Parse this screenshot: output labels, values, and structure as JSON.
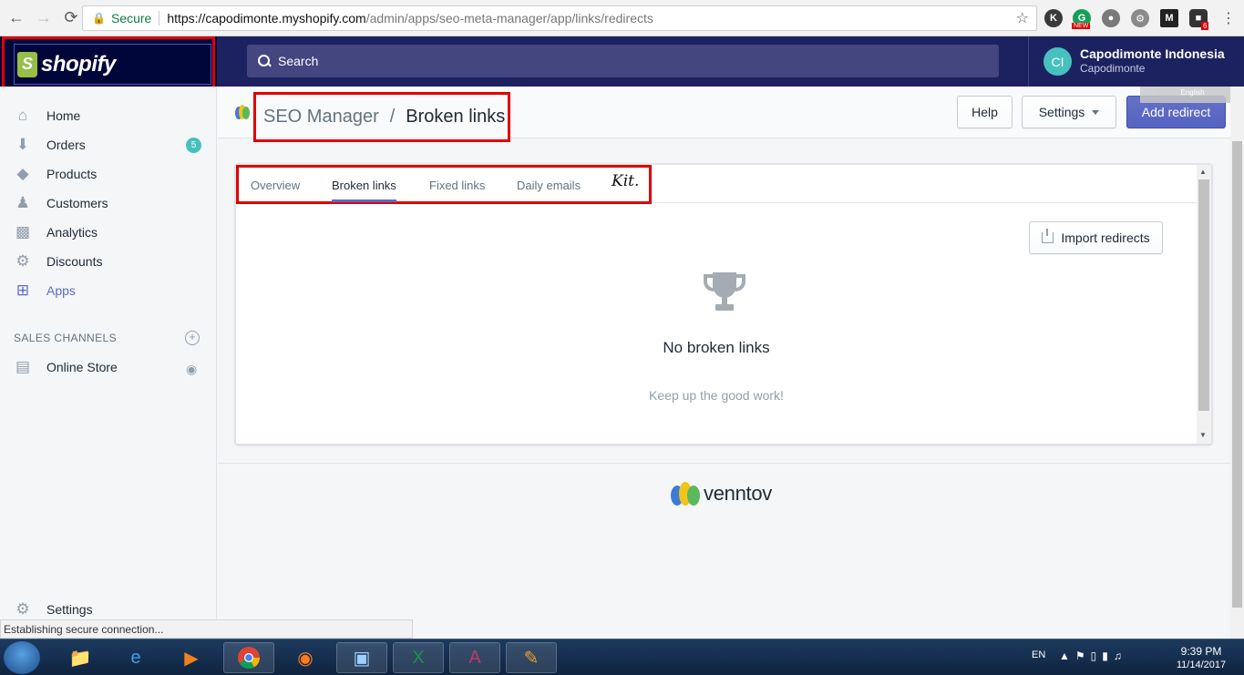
{
  "browser": {
    "secure_label": "Secure",
    "url_host": "https://capodimonte.myshopify.com",
    "url_path": "/admin/apps/seo-meta-manager/app/links/redirects",
    "ext_new_badge": "NEW",
    "ext_count_badge": "6"
  },
  "topbar": {
    "logo_text": "shopify",
    "search_placeholder": "Search",
    "avatar_initials": "CI",
    "store_name": "Capodimonte Indonesia",
    "store_sub": "Capodimonte",
    "language_pill": "English"
  },
  "sidebar": {
    "items": [
      {
        "label": "Home",
        "icon": "home-icon"
      },
      {
        "label": "Orders",
        "icon": "orders-icon",
        "badge": "5"
      },
      {
        "label": "Products",
        "icon": "tag-icon"
      },
      {
        "label": "Customers",
        "icon": "person-icon"
      },
      {
        "label": "Analytics",
        "icon": "bar-chart-icon"
      },
      {
        "label": "Discounts",
        "icon": "discount-icon"
      },
      {
        "label": "Apps",
        "icon": "apps-icon",
        "active": true
      }
    ],
    "sales_channels_label": "SALES CHANNELS",
    "online_store_label": "Online Store",
    "settings_label": "Settings"
  },
  "header": {
    "app_name": "SEO Manager",
    "separator": "/",
    "page_title": "Broken links",
    "help_label": "Help",
    "settings_label": "Settings",
    "add_redirect_label": "Add redirect"
  },
  "tabs": [
    {
      "label": "Overview"
    },
    {
      "label": "Broken links",
      "active": true
    },
    {
      "label": "Fixed links"
    },
    {
      "label": "Daily emails"
    }
  ],
  "tab_kit_label": "Kit.",
  "card": {
    "import_label": "Import redirects",
    "empty_title": "No broken links",
    "empty_subtitle": "Keep up the good work!"
  },
  "footer": {
    "brand": "venntov"
  },
  "status_bar": "Establishing secure connection...",
  "taskbar": {
    "language": "EN",
    "time": "9:39 PM",
    "date": "11/14/2017"
  },
  "colors": {
    "accent": "#5c6ac4",
    "topbar": "#1c2260",
    "highlight": "#e00000",
    "badge": "#47c1bf"
  }
}
